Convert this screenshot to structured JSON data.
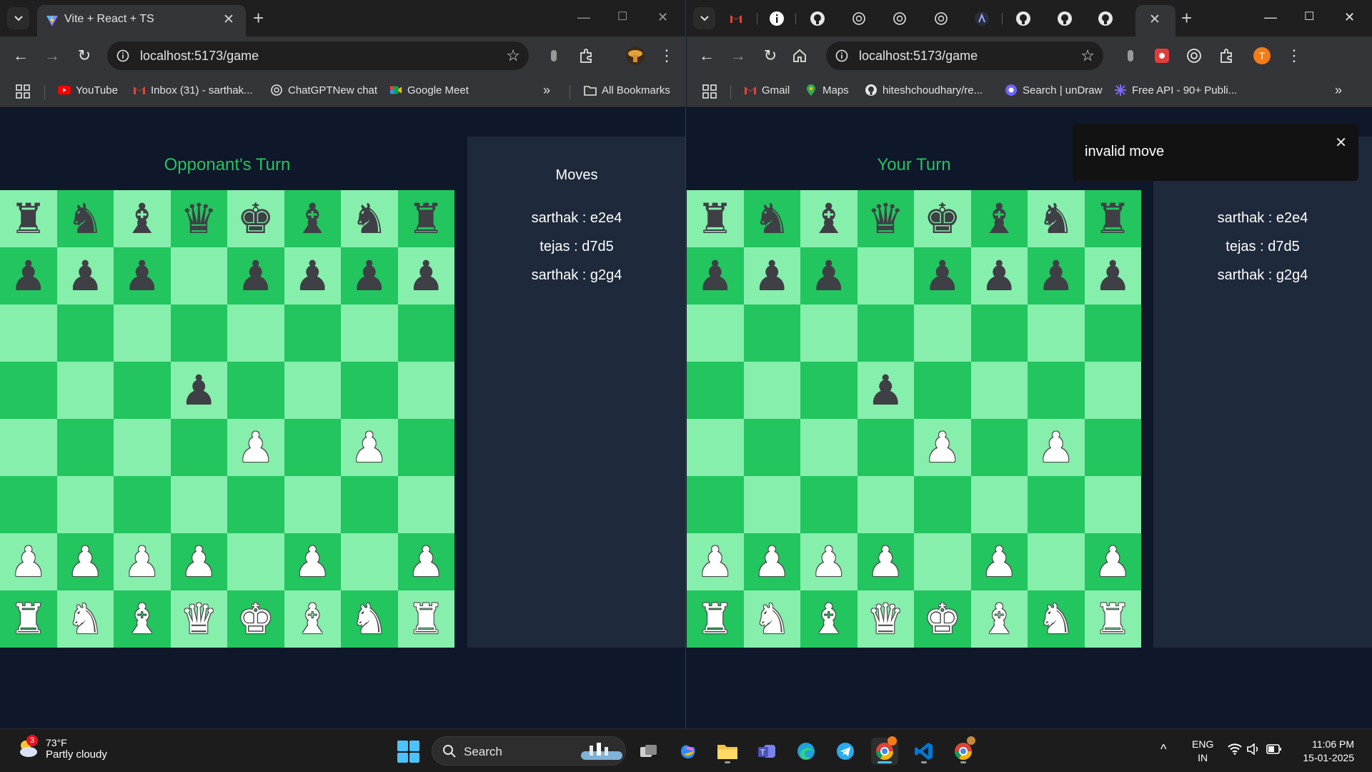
{
  "left_window": {
    "tab_title": "Vite + React + TS",
    "url": "localhost:5173/game",
    "bookmarks": [
      "YouTube",
      "Inbox (31) - sarthak...",
      "ChatGPTNew chat",
      "Google Meet"
    ],
    "all_bookmarks": "All Bookmarks",
    "turn_text": "Opponant's Turn",
    "moves_title": "Moves",
    "moves": [
      "sarthak : e2e4",
      "tejas : d7d5",
      "sarthak : g2g4"
    ]
  },
  "right_window": {
    "url": "localhost:5173/game",
    "bookmarks": [
      "Gmail",
      "Maps",
      "hiteshchoudhary/re...",
      "Search | unDraw",
      "Free API - 90+ Publi..."
    ],
    "turn_text": "Your Turn",
    "moves": [
      "sarthak : e2e4",
      "tejas : d7d5",
      "sarthak : g2g4"
    ],
    "toast_message": "invalid move",
    "profile_initial": "T"
  },
  "board": {
    "rows": [
      [
        "r",
        "n",
        "b",
        "q",
        "k",
        "b",
        "n",
        "r"
      ],
      [
        "p",
        "p",
        "p",
        "",
        "p",
        "p",
        "p",
        "p"
      ],
      [
        "",
        "",
        "",
        "",
        "",
        "",
        "",
        ""
      ],
      [
        "",
        "",
        "",
        "p",
        "",
        "",
        "",
        ""
      ],
      [
        "",
        "",
        "",
        "",
        "P",
        "",
        "P",
        ""
      ],
      [
        "",
        "",
        "",
        "",
        "",
        "",
        "",
        ""
      ],
      [
        "P",
        "P",
        "P",
        "P",
        "",
        "P",
        "",
        "P"
      ],
      [
        "R",
        "N",
        "B",
        "Q",
        "K",
        "B",
        "N",
        "R"
      ]
    ],
    "colors": {
      "light": "#86efac",
      "dark": "#22c55e"
    }
  },
  "taskbar": {
    "weather_temp": "73°F",
    "weather_cond": "Partly cloudy",
    "weather_badge": "3",
    "search_label": "Search",
    "lang": "ENG",
    "region": "IN",
    "time": "11:06 PM",
    "date": "15-01-2025"
  },
  "colors": {
    "accent_green": "#22c55e",
    "page_bg": "#0f172a",
    "panel_bg": "#1e293b"
  }
}
